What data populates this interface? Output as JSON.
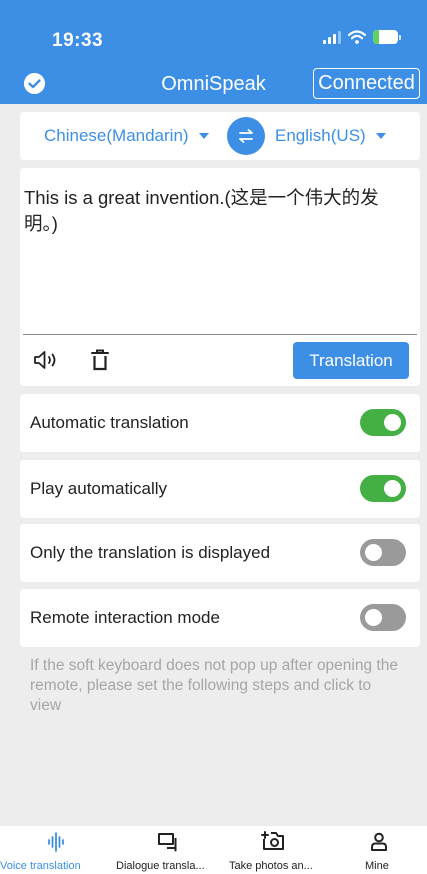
{
  "status_bar": {
    "time": "19:33",
    "battery": "23",
    "battery_level": 0.23
  },
  "header": {
    "title": "OmniSpeak",
    "connected_label": "Connected"
  },
  "languages": {
    "source": "Chinese(Mandarin)",
    "target": "English(US)"
  },
  "editor": {
    "text": "This is a great invention.(这是一个伟大的发明。)",
    "translate_label": "Translation"
  },
  "settings": [
    {
      "label": "Automatic translation",
      "enabled": true
    },
    {
      "label": "Play automatically",
      "enabled": true
    },
    {
      "label": "Only the translation is displayed",
      "enabled": false
    },
    {
      "label": "Remote interaction mode",
      "enabled": false
    }
  ],
  "hint": "If the soft keyboard does not pop up after opening the remote, please set the following steps and click to view",
  "tabs": [
    {
      "label": "Voice translation",
      "active": true
    },
    {
      "label": "Dialogue transla...",
      "active": false
    },
    {
      "label": "Take photos an...",
      "active": false
    },
    {
      "label": "Mine",
      "active": false
    }
  ],
  "colors": {
    "primary": "#3d8fe6",
    "toggle_on": "#44b043",
    "toggle_off": "#9a9a9a",
    "background": "#ededed"
  },
  "icons": [
    "check-circle-icon",
    "swap-icon",
    "speaker-icon",
    "trash-icon",
    "voice-wave-icon",
    "chat-icon",
    "camera-icon",
    "person-icon"
  ]
}
